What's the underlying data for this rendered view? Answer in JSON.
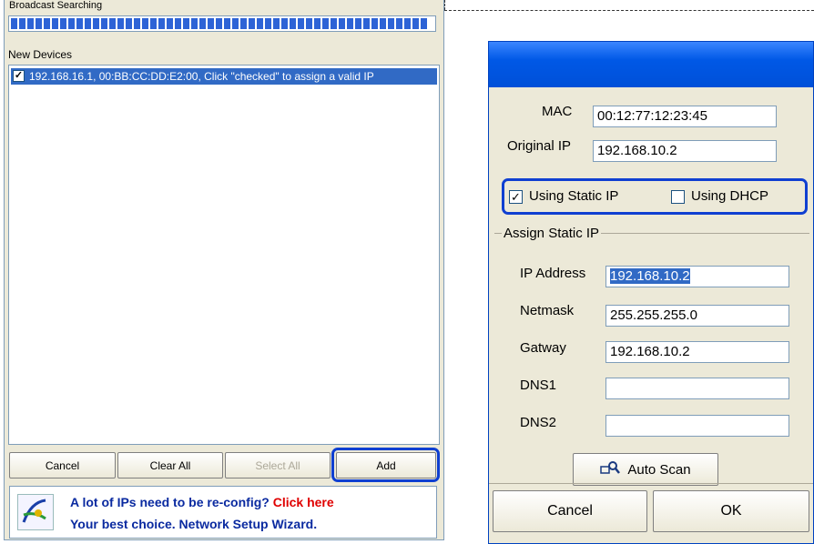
{
  "left": {
    "broadcast_label": "Broadcast Searching",
    "progress_percent": 100,
    "new_devices_label": "New Devices",
    "device_row": "192.168.16.1, 00:BB:CC:DD:E2:00, Click \"checked\" to assign a valid IP",
    "buttons": {
      "cancel": "Cancel",
      "clear_all": "Clear All",
      "select_all": "Select All",
      "add": "Add"
    },
    "banner": {
      "line1_prefix": "A lot of IPs need to be re-config?",
      "line1_link": "Click here",
      "line2": "Your best choice. Network Setup Wizard."
    }
  },
  "right": {
    "mac_label": "MAC",
    "mac_value": "00:12:77:12:23:45",
    "orig_ip_label": "Original IP",
    "orig_ip_value": "192.168.10.2",
    "static_ip_label": "Using Static IP",
    "static_ip_checked": true,
    "dhcp_label": "Using DHCP",
    "dhcp_checked": false,
    "group_label": "Assign Static IP",
    "ip_label": "IP Address",
    "ip_value": "192.168.10.2",
    "netmask_label": "Netmask",
    "netmask_value": "255.255.255.0",
    "gateway_label": "Gatway",
    "gateway_value": "192.168.10.2",
    "dns1_label": "DNS1",
    "dns1_value": "",
    "dns2_label": "DNS2",
    "dns2_value": "",
    "auto_scan": "Auto Scan",
    "cancel": "Cancel",
    "ok": "OK"
  },
  "colors": {
    "highlight_border": "#0f3fd1",
    "selection": "#316ac5",
    "progress": "#2d63d6",
    "link_red": "#e00000"
  }
}
